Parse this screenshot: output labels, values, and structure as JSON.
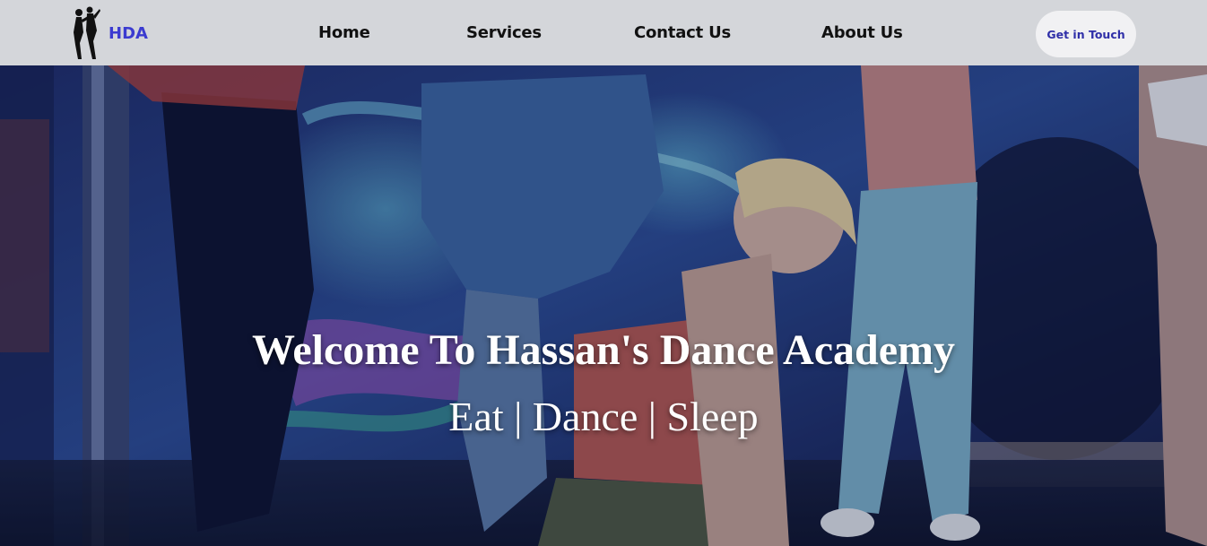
{
  "brand": {
    "logo_text": "HDA",
    "logo_icon": "dancing-couple-silhouette-icon"
  },
  "nav": {
    "items": [
      "Home",
      "Services",
      "Contact Us",
      "About Us"
    ]
  },
  "cta": {
    "label": "Get in Touch"
  },
  "hero": {
    "title": "Welcome To Hassan's Dance Academy",
    "tagline": "Eat | Dance | Sleep",
    "image": "dancers-graffiti-background"
  },
  "colors": {
    "navbar_bg": "#d4d6da",
    "logo_text": "#3b3bd0",
    "cta_text": "#2f2fa8",
    "cta_bg": "#f1f1f3"
  }
}
